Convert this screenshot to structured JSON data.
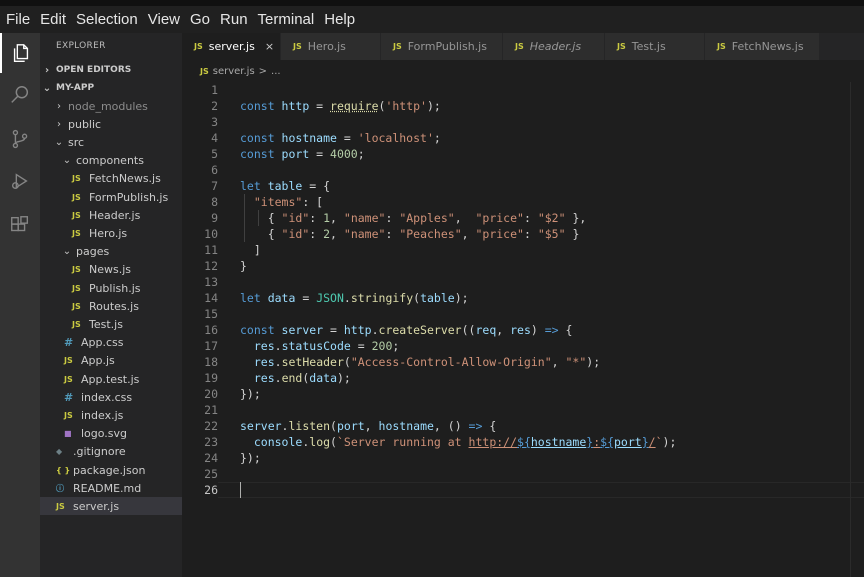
{
  "menu": [
    "File",
    "Edit",
    "Selection",
    "View",
    "Go",
    "Run",
    "Terminal",
    "Help"
  ],
  "activity_bar": [
    "files-icon",
    "search-icon",
    "source-control-icon",
    "run-debug-icon",
    "extensions-icon"
  ],
  "explorer": {
    "title": "EXPLORER",
    "open_editors": "OPEN EDITORS",
    "project": "MY-APP",
    "tree": [
      {
        "label": "node_modules",
        "type": "folder",
        "state": "collapsed",
        "depth": 1
      },
      {
        "label": "public",
        "type": "folder",
        "state": "collapsed",
        "depth": 1
      },
      {
        "label": "src",
        "type": "folder",
        "state": "expanded",
        "depth": 1
      },
      {
        "label": "components",
        "type": "folder",
        "state": "expanded",
        "depth": 2
      },
      {
        "label": "FetchNews.js",
        "type": "js",
        "depth": 3
      },
      {
        "label": "FormPublish.js",
        "type": "js",
        "depth": 3
      },
      {
        "label": "Header.js",
        "type": "js",
        "depth": 3
      },
      {
        "label": "Hero.js",
        "type": "js",
        "depth": 3
      },
      {
        "label": "pages",
        "type": "folder",
        "state": "expanded",
        "depth": 2
      },
      {
        "label": "News.js",
        "type": "js",
        "depth": 3
      },
      {
        "label": "Publish.js",
        "type": "js",
        "depth": 3
      },
      {
        "label": "Routes.js",
        "type": "js",
        "depth": 3
      },
      {
        "label": "Test.js",
        "type": "js",
        "depth": 3
      },
      {
        "label": "App.css",
        "type": "css",
        "depth": 2
      },
      {
        "label": "App.js",
        "type": "js",
        "depth": 2
      },
      {
        "label": "App.test.js",
        "type": "js",
        "depth": 2
      },
      {
        "label": "index.css",
        "type": "css",
        "depth": 2
      },
      {
        "label": "index.js",
        "type": "js",
        "depth": 2
      },
      {
        "label": "logo.svg",
        "type": "svg",
        "depth": 2
      },
      {
        "label": ".gitignore",
        "type": "git",
        "depth": 1
      },
      {
        "label": "package.json",
        "type": "json",
        "depth": 1
      },
      {
        "label": "README.md",
        "type": "md",
        "depth": 1
      },
      {
        "label": "server.js",
        "type": "js",
        "depth": 1,
        "selected": true
      }
    ]
  },
  "icons": {
    "js": "JS",
    "css": "#",
    "json": "{ }",
    "git": "◆",
    "md": "ⓘ",
    "svg": "■"
  },
  "tabs": [
    {
      "label": "server.js",
      "active": true,
      "close": "×"
    },
    {
      "label": "Hero.js"
    },
    {
      "label": "FormPublish.js"
    },
    {
      "label": "Header.js",
      "italic": true
    },
    {
      "label": "Test.js"
    },
    {
      "label": "FetchNews.js"
    }
  ],
  "breadcrumb": {
    "file": "server.js",
    "sep": ">",
    "rest": "..."
  },
  "editor": {
    "current_line": 26,
    "lines": [
      [],
      [
        [
          "const ",
          "kw"
        ],
        [
          "http",
          "var"
        ],
        [
          " = ",
          "pun"
        ],
        [
          "require",
          "fn ul"
        ],
        [
          "(",
          "pun"
        ],
        [
          "'http'",
          "str"
        ],
        [
          ");",
          "pun"
        ]
      ],
      [],
      [
        [
          "const ",
          "kw"
        ],
        [
          "hostname",
          "var"
        ],
        [
          " = ",
          "pun"
        ],
        [
          "'localhost'",
          "str"
        ],
        [
          ";",
          "pun"
        ]
      ],
      [
        [
          "const ",
          "kw"
        ],
        [
          "port",
          "var"
        ],
        [
          " = ",
          "pun"
        ],
        [
          "4000",
          "num"
        ],
        [
          ";",
          "pun"
        ]
      ],
      [],
      [
        [
          "let ",
          "kw"
        ],
        [
          "table",
          "var"
        ],
        [
          " = {",
          "pun"
        ]
      ],
      [
        [
          "  ",
          "pun"
        ],
        [
          "\"items\"",
          "str"
        ],
        [
          ": [",
          "pun"
        ]
      ],
      [
        [
          "    { ",
          "pun"
        ],
        [
          "\"id\"",
          "str"
        ],
        [
          ": ",
          "pun"
        ],
        [
          "1",
          "num"
        ],
        [
          ", ",
          "pun"
        ],
        [
          "\"name\"",
          "str"
        ],
        [
          ": ",
          "pun"
        ],
        [
          "\"Apples\"",
          "str"
        ],
        [
          ",  ",
          "pun"
        ],
        [
          "\"price\"",
          "str"
        ],
        [
          ": ",
          "pun"
        ],
        [
          "\"$2\"",
          "str"
        ],
        [
          " },",
          "pun"
        ]
      ],
      [
        [
          "    { ",
          "pun"
        ],
        [
          "\"id\"",
          "str"
        ],
        [
          ": ",
          "pun"
        ],
        [
          "2",
          "num"
        ],
        [
          ", ",
          "pun"
        ],
        [
          "\"name\"",
          "str"
        ],
        [
          ": ",
          "pun"
        ],
        [
          "\"Peaches\"",
          "str"
        ],
        [
          ", ",
          "pun"
        ],
        [
          "\"price\"",
          "str"
        ],
        [
          ": ",
          "pun"
        ],
        [
          "\"$5\"",
          "str"
        ],
        [
          " }",
          "pun"
        ]
      ],
      [
        [
          "  ]",
          "pun"
        ]
      ],
      [
        [
          "}",
          "pun"
        ]
      ],
      [],
      [
        [
          "let ",
          "kw"
        ],
        [
          "data",
          "var"
        ],
        [
          " = ",
          "pun"
        ],
        [
          "JSON",
          "cls"
        ],
        [
          ".",
          "pun"
        ],
        [
          "stringify",
          "fn"
        ],
        [
          "(",
          "pun"
        ],
        [
          "table",
          "var"
        ],
        [
          ");",
          "pun"
        ]
      ],
      [],
      [
        [
          "const ",
          "kw"
        ],
        [
          "server",
          "var"
        ],
        [
          " = ",
          "pun"
        ],
        [
          "http",
          "var"
        ],
        [
          ".",
          "pun"
        ],
        [
          "createServer",
          "fn"
        ],
        [
          "((",
          "pun"
        ],
        [
          "req",
          "var"
        ],
        [
          ", ",
          "pun"
        ],
        [
          "res",
          "var"
        ],
        [
          ") ",
          "pun"
        ],
        [
          "=>",
          "kw"
        ],
        [
          " {",
          "pun"
        ]
      ],
      [
        [
          "  ",
          "pun"
        ],
        [
          "res",
          "var"
        ],
        [
          ".",
          "pun"
        ],
        [
          "statusCode",
          "var"
        ],
        [
          " = ",
          "pun"
        ],
        [
          "200",
          "num"
        ],
        [
          ";",
          "pun"
        ]
      ],
      [
        [
          "  ",
          "pun"
        ],
        [
          "res",
          "var"
        ],
        [
          ".",
          "pun"
        ],
        [
          "setHeader",
          "fn"
        ],
        [
          "(",
          "pun"
        ],
        [
          "\"Access-Control-Allow-Origin\"",
          "str"
        ],
        [
          ", ",
          "pun"
        ],
        [
          "\"*\"",
          "str"
        ],
        [
          ");",
          "pun"
        ]
      ],
      [
        [
          "  ",
          "pun"
        ],
        [
          "res",
          "var"
        ],
        [
          ".",
          "pun"
        ],
        [
          "end",
          "fn"
        ],
        [
          "(",
          "pun"
        ],
        [
          "data",
          "var"
        ],
        [
          ");",
          "pun"
        ]
      ],
      [
        [
          "});",
          "pun"
        ]
      ],
      [],
      [
        [
          "server",
          "var"
        ],
        [
          ".",
          "pun"
        ],
        [
          "listen",
          "fn"
        ],
        [
          "(",
          "pun"
        ],
        [
          "port",
          "var"
        ],
        [
          ", ",
          "pun"
        ],
        [
          "hostname",
          "var"
        ],
        [
          ", () ",
          "pun"
        ],
        [
          "=>",
          "kw"
        ],
        [
          " {",
          "pun"
        ]
      ],
      [
        [
          "  ",
          "pun"
        ],
        [
          "console",
          "var"
        ],
        [
          ".",
          "pun"
        ],
        [
          "log",
          "fn"
        ],
        [
          "(",
          "pun"
        ],
        [
          "`Server running at ",
          "str"
        ],
        [
          "http://",
          "str link"
        ],
        [
          "${",
          "kw link"
        ],
        [
          "hostname",
          "var link"
        ],
        [
          "}",
          "kw link"
        ],
        [
          ":",
          "str link"
        ],
        [
          "${",
          "kw link"
        ],
        [
          "port",
          "var link"
        ],
        [
          "}",
          "kw link"
        ],
        [
          "/",
          "str link"
        ],
        [
          "`",
          "str"
        ],
        [
          ");",
          "pun"
        ]
      ],
      [
        [
          "});",
          "pun"
        ]
      ],
      [],
      []
    ]
  }
}
